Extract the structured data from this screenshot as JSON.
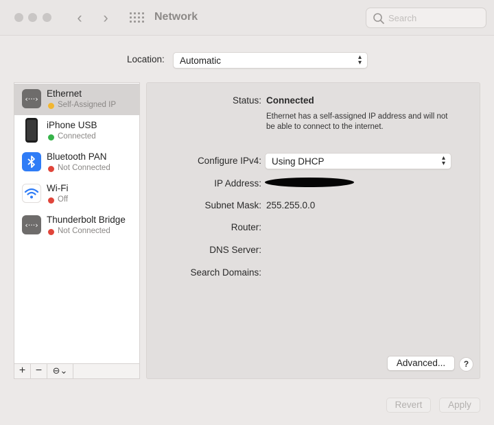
{
  "window": {
    "title": "Network",
    "nav_back": "‹",
    "nav_forward": "›"
  },
  "search": {
    "placeholder": "Search",
    "value": ""
  },
  "location": {
    "label": "Location:",
    "value": "Automatic"
  },
  "services": [
    {
      "name": "Ethernet",
      "status": "Self-Assigned IP",
      "status_color": "#f2b631",
      "icon": "ethernet-icon",
      "selected": true
    },
    {
      "name": "iPhone USB",
      "status": "Connected",
      "status_color": "#36b34a",
      "icon": "iphone-icon",
      "selected": false
    },
    {
      "name": "Bluetooth PAN",
      "status": "Not Connected",
      "status_color": "#e0453a",
      "icon": "bluetooth-icon",
      "selected": false
    },
    {
      "name": "Wi-Fi",
      "status": "Off",
      "status_color": "#e0453a",
      "icon": "wifi-icon",
      "selected": false
    },
    {
      "name": "Thunderbolt Bridge",
      "status": "Not Connected",
      "status_color": "#e0453a",
      "icon": "thunderbolt-bridge-icon",
      "selected": false
    }
  ],
  "sidebar_tools": {
    "add": "+",
    "remove": "−",
    "action": "⊖⌄"
  },
  "detail": {
    "status_label": "Status:",
    "status_value": "Connected",
    "status_description": "Ethernet has a self-assigned IP address and will not be able to connect to the internet.",
    "configure_label": "Configure IPv4:",
    "configure_value": "Using DHCP",
    "ip_label": "IP Address:",
    "subnet_label": "Subnet Mask:",
    "subnet_value": "255.255.0.0",
    "router_label": "Router:",
    "dns_label": "DNS Server:",
    "search_domains_label": "Search Domains:",
    "advanced_button": "Advanced...",
    "help_button": "?"
  },
  "footer": {
    "revert": "Revert",
    "apply": "Apply"
  },
  "colors": {
    "accent_blue": "#2f7cf6",
    "selected_row": "#d6d3d2"
  }
}
